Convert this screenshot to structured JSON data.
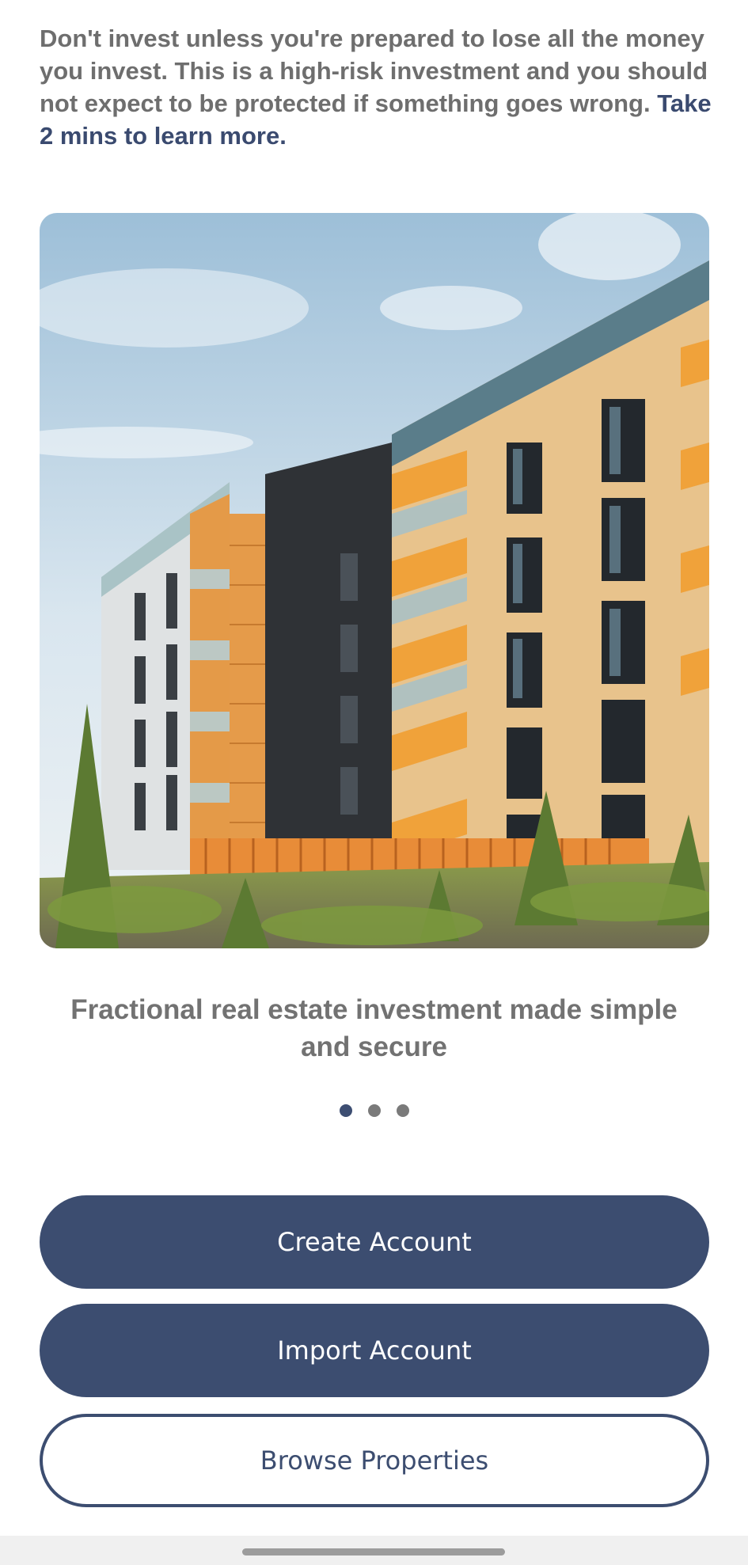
{
  "risk_warning": {
    "text": "Don't invest unless you're prepared to lose all the money you invest. This is a high-risk investment and you should not expect to be protected if something goes wrong.",
    "link_text": "Take 2 mins to learn more."
  },
  "carousel": {
    "tagline": "Fractional real estate investment made simple and secure",
    "page_count": 3,
    "active_index": 0
  },
  "buttons": {
    "create_account": "Create Account",
    "import_account": "Import Account",
    "browse_properties": "Browse Properties"
  },
  "colors": {
    "primary": "#3c4d70",
    "text_gray": "#6e6e6e",
    "link": "#3a4a6f"
  }
}
